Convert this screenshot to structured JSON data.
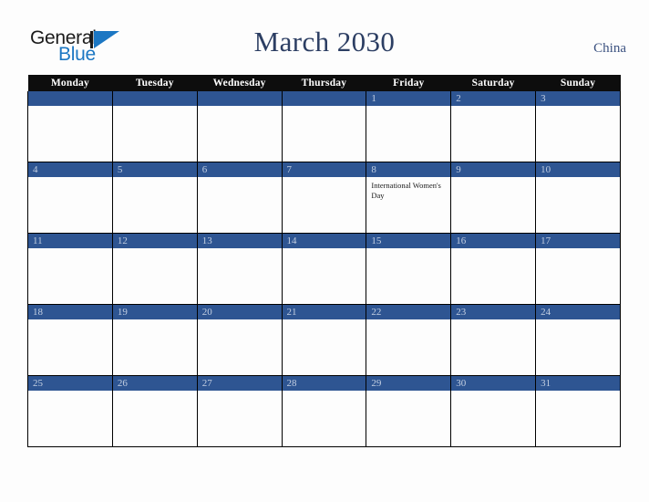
{
  "logo": {
    "word_general": "General",
    "word_blue": "Blue",
    "mark": "triangle-mark"
  },
  "header": {
    "title": "March 2030",
    "country": "China"
  },
  "calendar": {
    "weekday_headers": [
      "Monday",
      "Tuesday",
      "Wednesday",
      "Thursday",
      "Friday",
      "Saturday",
      "Sunday"
    ],
    "colors": {
      "date_bar": "#2e5592",
      "header_bar": "#0d0d0d",
      "title_text": "#2c3e63",
      "country_text": "#3c5280",
      "logo_blue": "#1c77c3",
      "cell_background": "#fdfdfd"
    },
    "weeks": [
      [
        {
          "day": "",
          "events": []
        },
        {
          "day": "",
          "events": []
        },
        {
          "day": "",
          "events": []
        },
        {
          "day": "",
          "events": []
        },
        {
          "day": "1",
          "events": []
        },
        {
          "day": "2",
          "events": []
        },
        {
          "day": "3",
          "events": []
        }
      ],
      [
        {
          "day": "4",
          "events": []
        },
        {
          "day": "5",
          "events": []
        },
        {
          "day": "6",
          "events": []
        },
        {
          "day": "7",
          "events": []
        },
        {
          "day": "8",
          "events": [
            "International Women's Day"
          ]
        },
        {
          "day": "9",
          "events": []
        },
        {
          "day": "10",
          "events": []
        }
      ],
      [
        {
          "day": "11",
          "events": []
        },
        {
          "day": "12",
          "events": []
        },
        {
          "day": "13",
          "events": []
        },
        {
          "day": "14",
          "events": []
        },
        {
          "day": "15",
          "events": []
        },
        {
          "day": "16",
          "events": []
        },
        {
          "day": "17",
          "events": []
        }
      ],
      [
        {
          "day": "18",
          "events": []
        },
        {
          "day": "19",
          "events": []
        },
        {
          "day": "20",
          "events": []
        },
        {
          "day": "21",
          "events": []
        },
        {
          "day": "22",
          "events": []
        },
        {
          "day": "23",
          "events": []
        },
        {
          "day": "24",
          "events": []
        }
      ],
      [
        {
          "day": "25",
          "events": []
        },
        {
          "day": "26",
          "events": []
        },
        {
          "day": "27",
          "events": []
        },
        {
          "day": "28",
          "events": []
        },
        {
          "day": "29",
          "events": []
        },
        {
          "day": "30",
          "events": []
        },
        {
          "day": "31",
          "events": []
        }
      ]
    ]
  }
}
